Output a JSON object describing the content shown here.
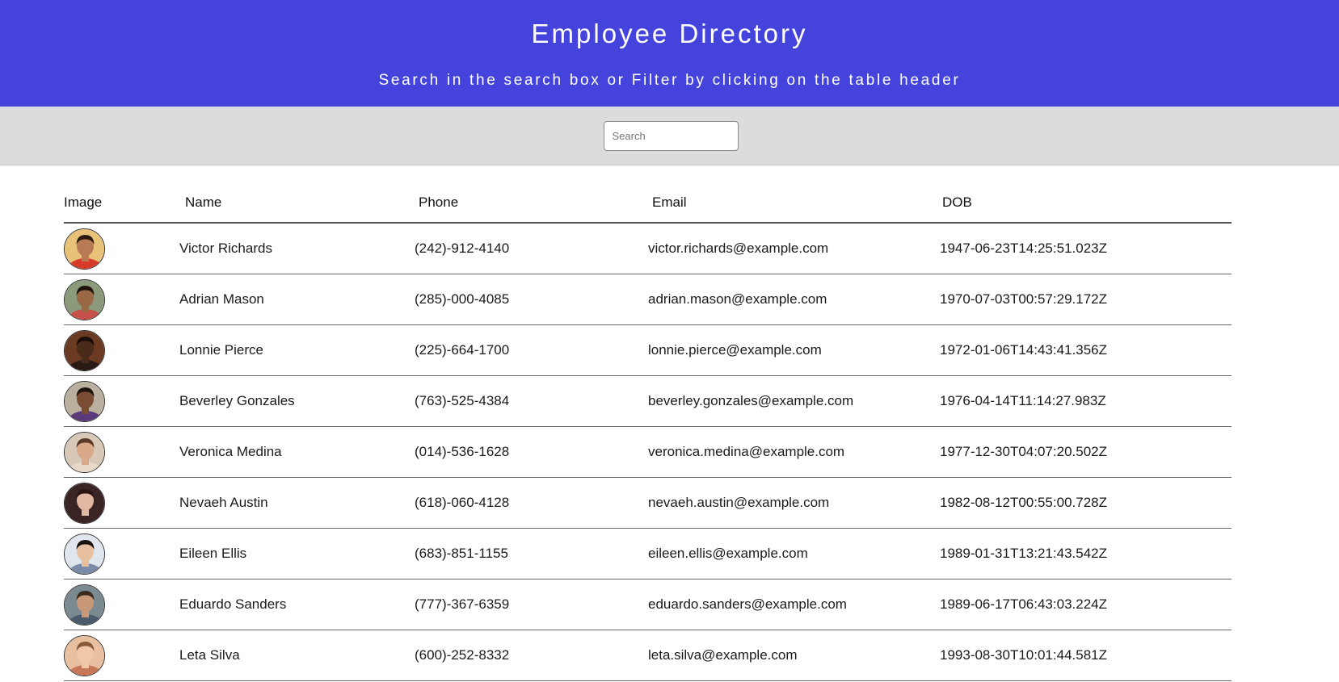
{
  "header": {
    "title": "Employee Directory",
    "subtitle": "Search in the search box or Filter by clicking on the table header"
  },
  "search": {
    "placeholder": "Search",
    "value": ""
  },
  "table": {
    "columns": [
      "Image",
      "Name",
      "Phone",
      "Email",
      "DOB"
    ],
    "rows": [
      {
        "name": "Victor Richards",
        "phone": "(242)-912-4140",
        "email": "victor.richards@example.com",
        "dob": "1947-06-23T14:25:51.023Z"
      },
      {
        "name": "Adrian Mason",
        "phone": "(285)-000-4085",
        "email": "adrian.mason@example.com",
        "dob": "1970-07-03T00:57:29.172Z"
      },
      {
        "name": "Lonnie Pierce",
        "phone": "(225)-664-1700",
        "email": "lonnie.pierce@example.com",
        "dob": "1972-01-06T14:43:41.356Z"
      },
      {
        "name": "Beverley Gonzales",
        "phone": "(763)-525-4384",
        "email": "beverley.gonzales@example.com",
        "dob": "1976-04-14T11:14:27.983Z"
      },
      {
        "name": "Veronica Medina",
        "phone": "(014)-536-1628",
        "email": "veronica.medina@example.com",
        "dob": "1977-12-30T04:07:20.502Z"
      },
      {
        "name": "Nevaeh Austin",
        "phone": "(618)-060-4128",
        "email": "nevaeh.austin@example.com",
        "dob": "1982-08-12T00:55:00.728Z"
      },
      {
        "name": "Eileen Ellis",
        "phone": "(683)-851-1155",
        "email": "eileen.ellis@example.com",
        "dob": "1989-01-31T13:21:43.542Z"
      },
      {
        "name": "Eduardo Sanders",
        "phone": "(777)-367-6359",
        "email": "eduardo.sanders@example.com",
        "dob": "1989-06-17T06:43:03.224Z"
      },
      {
        "name": "Leta Silva",
        "phone": "(600)-252-8332",
        "email": "leta.silva@example.com",
        "dob": "1993-08-30T10:01:44.581Z"
      }
    ]
  },
  "colors": {
    "header_bg": "#4444dd",
    "search_bar_bg": "#dcdcdc",
    "avatars": [
      {
        "bg": "#e9c27a",
        "skin": "#b77a55",
        "hair": "#2a1a10",
        "shirt": "#d83a2a"
      },
      {
        "bg": "#8a9a7a",
        "skin": "#9a6845",
        "hair": "#1e140c",
        "shirt": "#c8504a"
      },
      {
        "bg": "#6a3a22",
        "skin": "#4a2b1a",
        "hair": "#1a0f08",
        "shirt": "#2a1a14"
      },
      {
        "bg": "#b9b0a0",
        "skin": "#7a4d33",
        "hair": "#1f140d",
        "shirt": "#5a3a7a"
      },
      {
        "bg": "#d8c8b8",
        "skin": "#d8a888",
        "hair": "#5a3a28",
        "shirt": "#e8d8c8"
      },
      {
        "bg": "#3a2424",
        "skin": "#e2b8a2",
        "hair": "#2a1612",
        "shirt": "#3a2424"
      },
      {
        "bg": "#dfe6ee",
        "skin": "#e8c0a0",
        "hair": "#1a1410",
        "shirt": "#7a8aa8"
      },
      {
        "bg": "#7a8a90",
        "skin": "#c89878",
        "hair": "#3a2a1e",
        "shirt": "#4a5a6a"
      },
      {
        "bg": "#e8c0a0",
        "skin": "#f0c8a8",
        "hair": "#8a5a38",
        "shirt": "#c87858"
      }
    ]
  }
}
